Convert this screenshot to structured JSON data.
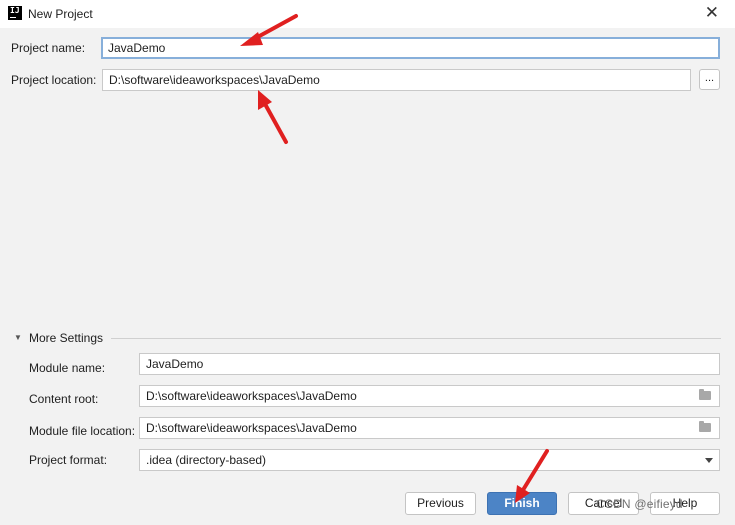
{
  "dialog": {
    "title": "New Project",
    "app_icon": "IJ",
    "close_icon": "close-icon"
  },
  "project": {
    "name_label": "Project name:",
    "name_value": "JavaDemo",
    "location_label": "Project location:",
    "location_value": "D:\\software\\ideaworkspaces\\JavaDemo",
    "browse_label": "..."
  },
  "more_settings": {
    "title": "More Settings",
    "module_name_label": "Module name:",
    "module_name_value": "JavaDemo",
    "content_root_label": "Content root:",
    "content_root_value": "D:\\software\\ideaworkspaces\\JavaDemo",
    "module_file_label": "Module file location:",
    "module_file_value": "D:\\software\\ideaworkspaces\\JavaDemo",
    "format_label": "Project format:",
    "format_value": ".idea (directory-based)"
  },
  "buttons": {
    "previous": "Previous",
    "finish": "Finish",
    "cancel": "Cancel",
    "help": "Help"
  },
  "watermark": "CSDN @eifieyd",
  "colors": {
    "primary_button": "#4c84c6",
    "annotation_arrow": "#e02020",
    "focus_border": "#87afda"
  }
}
